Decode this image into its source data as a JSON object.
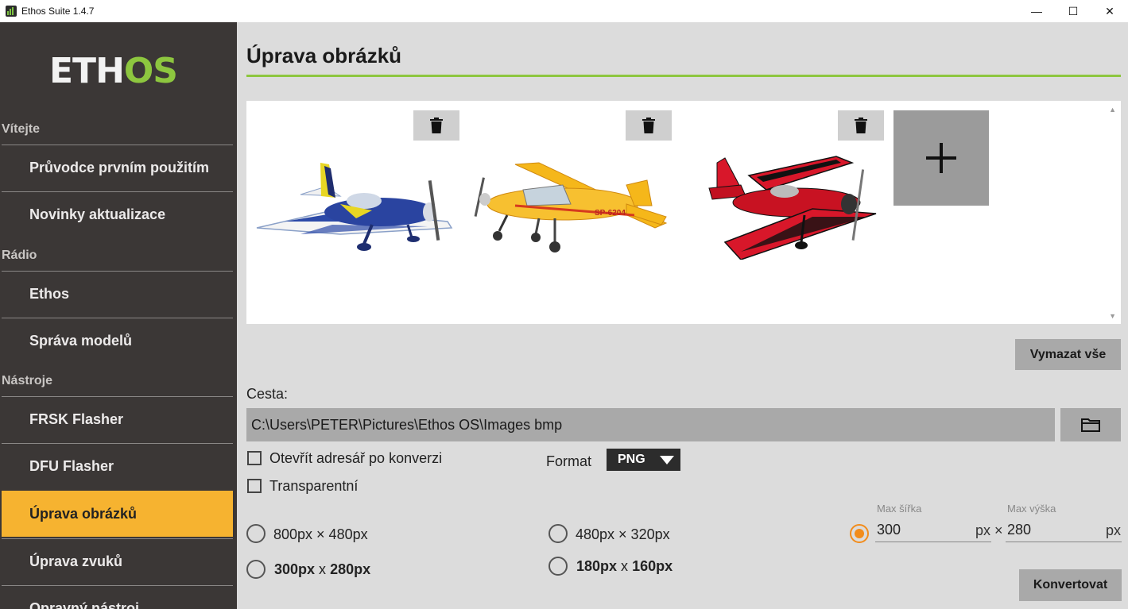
{
  "window": {
    "title": "Ethos Suite 1.4.7",
    "minimize": "—",
    "maximize": "☐",
    "close": "✕"
  },
  "logo": {
    "part1": "ETH",
    "part2": "OS"
  },
  "sidebar": {
    "sections": [
      {
        "label": "Vítejte"
      },
      {
        "label": "Rádio"
      },
      {
        "label": "Nástroje"
      }
    ],
    "items": [
      {
        "label": "Průvodce prvním použitím"
      },
      {
        "label": "Novinky aktualizace"
      },
      {
        "label": "Ethos"
      },
      {
        "label": "Správa modelů"
      },
      {
        "label": "FRSK Flasher"
      },
      {
        "label": "DFU Flasher"
      },
      {
        "label": "Úprava obrázků",
        "active": true
      },
      {
        "label": "Úprava zvuků"
      },
      {
        "label": "Opravný nástroj"
      }
    ]
  },
  "page": {
    "title": "Úprava obrázků"
  },
  "gallery": {
    "images": [
      {
        "icon": "blue-aerobatic-plane"
      },
      {
        "icon": "yellow-high-wing-plane"
      },
      {
        "icon": "red-biplane"
      }
    ],
    "add_icon": "plus-icon"
  },
  "buttons": {
    "clear_all": "Vymazat vše",
    "convert": "Konvertovat"
  },
  "path": {
    "label": "Cesta:",
    "value": "C:\\Users\\PETER\\Pictures\\Ethos OS\\Images bmp"
  },
  "options": {
    "open_folder": "Otevřít adresář po konverzi",
    "transparent": "Transparentní",
    "format_label": "Format",
    "format_value": "PNG"
  },
  "sizes": {
    "r1": "800px × 480px",
    "r2": "480px × 320px",
    "r3a": "300px",
    "r3x": " x ",
    "r3b": "280px",
    "r4a": "180px",
    "r4x": " x ",
    "r4b": "160px",
    "custom": {
      "max_width_label": "Max šířka",
      "max_height_label": "Max výška",
      "width": "300",
      "height": "280",
      "unit_px_times": "px ×",
      "unit_px": "px"
    }
  },
  "colors": {
    "accent_green": "#8dc63f",
    "active_nav": "#f6b330",
    "radio_on": "#f28c1b"
  }
}
